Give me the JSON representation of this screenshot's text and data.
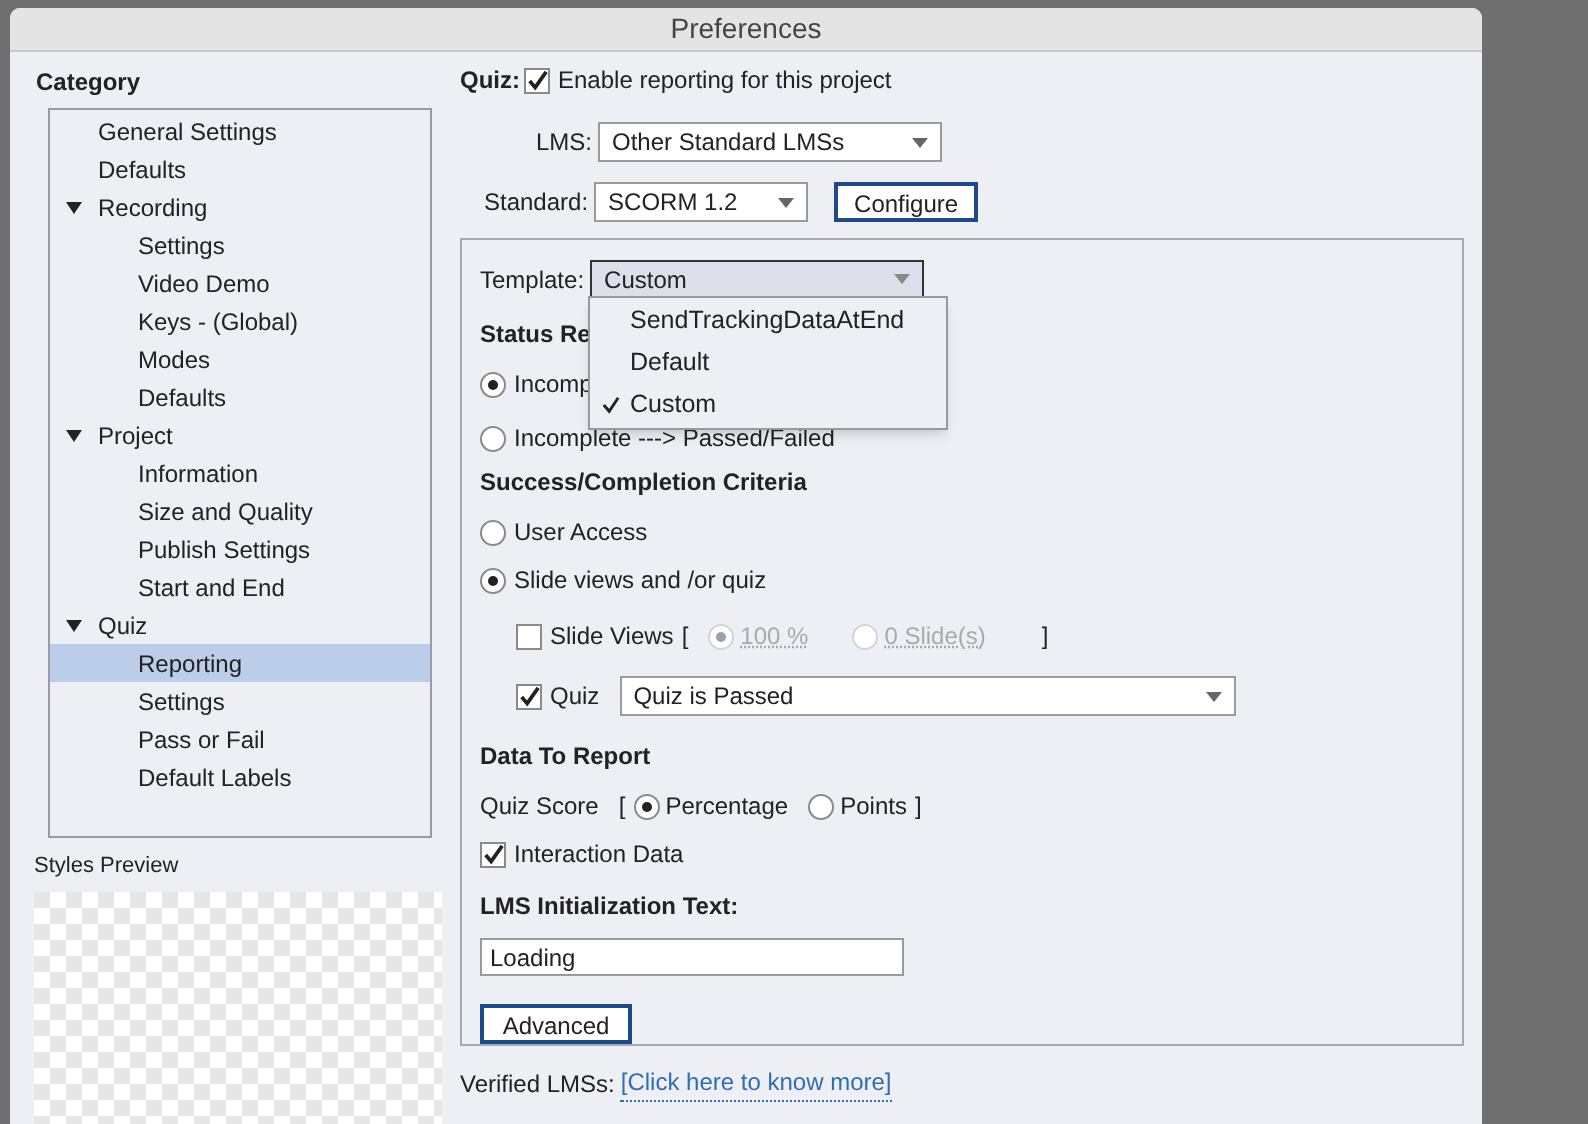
{
  "window": {
    "title": "Preferences"
  },
  "category": {
    "label": "Category",
    "items": [
      {
        "label": "General Settings"
      },
      {
        "label": "Defaults"
      },
      {
        "label": "Recording",
        "expanded": true,
        "children": [
          {
            "label": "Settings",
            "selected": false
          },
          {
            "label": "Video Demo",
            "selected": false
          },
          {
            "label": "Keys - (Global)",
            "selected": false
          },
          {
            "label": "Modes",
            "selected": false
          },
          {
            "label": "Defaults",
            "selected": false
          }
        ]
      },
      {
        "label": "Project",
        "expanded": true,
        "children": [
          {
            "label": "Information",
            "selected": false
          },
          {
            "label": "Size and Quality",
            "selected": false
          },
          {
            "label": "Publish Settings",
            "selected": false
          },
          {
            "label": "Start and End",
            "selected": false
          }
        ]
      },
      {
        "label": "Quiz",
        "expanded": true,
        "children": [
          {
            "label": "Reporting",
            "selected": true
          },
          {
            "label": "Settings",
            "selected": false
          },
          {
            "label": "Pass or Fail",
            "selected": false
          },
          {
            "label": "Default Labels",
            "selected": false
          }
        ]
      }
    ]
  },
  "styles_preview": {
    "label": "Styles Preview"
  },
  "quiz": {
    "label": "Quiz:",
    "checked": true,
    "text": "Enable reporting for this project"
  },
  "lms": {
    "label": "LMS:",
    "value": "Other Standard LMSs"
  },
  "standard": {
    "label": "Standard:",
    "value": "SCORM 1.2",
    "button": "Configure"
  },
  "template": {
    "label": "Template:",
    "value": "Custom",
    "menu": [
      {
        "label": "SendTrackingDataAtEnd",
        "selected": false
      },
      {
        "label": "Default",
        "selected": false
      },
      {
        "label": "Custom",
        "selected": true
      }
    ]
  },
  "status_report": {
    "heading": "Status Re",
    "options": [
      {
        "label": "Incomp",
        "selected": true
      },
      {
        "label": "Incomplete ---> Passed/Failed",
        "selected": false
      }
    ]
  },
  "criteria": {
    "heading": "Success/Completion Criteria",
    "options": [
      {
        "label": "User Access",
        "selected": false
      },
      {
        "label": "Slide views and /or quiz",
        "selected": true
      }
    ],
    "slide_views": {
      "label": "Slide Views",
      "checked": false,
      "open": "[",
      "close": "]",
      "options": [
        {
          "label": "100 %",
          "selected": true
        },
        {
          "label": "0 Slide(s)",
          "selected": false
        }
      ]
    },
    "quiz": {
      "label": "Quiz",
      "checked": true,
      "value": "Quiz is Passed"
    }
  },
  "data_to_report": {
    "heading": "Data To Report",
    "quiz_score": {
      "label": "Quiz Score",
      "open": "[",
      "close": "]",
      "options": [
        {
          "label": "Percentage",
          "selected": true
        },
        {
          "label": "Points",
          "selected": false
        }
      ]
    },
    "interaction": {
      "label": "Interaction Data",
      "checked": true
    }
  },
  "init_text": {
    "heading": "LMS Initialization Text:",
    "value": "Loading"
  },
  "advanced_button": "Advanced",
  "verified": {
    "label": "Verified LMSs:",
    "link": "[Click here to know more]"
  }
}
